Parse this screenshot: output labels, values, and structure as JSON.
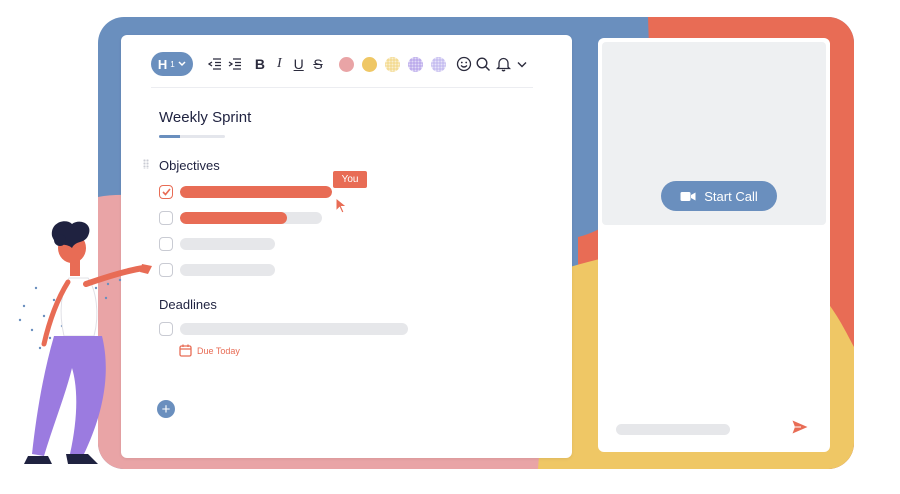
{
  "colors": {
    "blue": "#6a8fbe",
    "coral": "#e86c55",
    "pink": "#e9a4a6",
    "yellow": "#efc765",
    "purple": "#9b7be0"
  },
  "toolbar": {
    "heading_label": "H",
    "heading_sub": "1",
    "bold_label": "B",
    "italic_label": "I",
    "underline_label": "U",
    "strike_label": "S",
    "swatches": [
      "#e9a4a6",
      "#efc765",
      "#f3d88a",
      "#b6a4ea",
      "#c2b9ef"
    ]
  },
  "document": {
    "title": "Weekly Sprint",
    "title_progress": 0.32,
    "objectives_heading": "Objectives",
    "deadlines_heading": "Deadlines",
    "due_label": "Due Today",
    "you_tag": "You",
    "add_label": "+",
    "objectives": [
      {
        "checked": true,
        "progress": 1.0
      },
      {
        "checked": false,
        "progress": 0.75
      },
      {
        "checked": false,
        "progress": 0
      },
      {
        "checked": false,
        "progress": 0
      }
    ],
    "deadlines": [
      {
        "checked": false,
        "progress": 0
      }
    ]
  },
  "call_panel": {
    "start_call_label": "Start Call"
  }
}
